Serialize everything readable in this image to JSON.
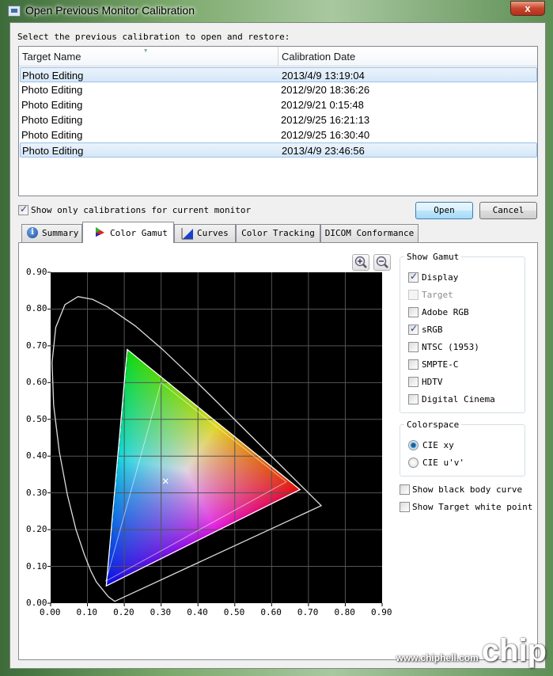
{
  "window": {
    "title": "Open Previous Monitor Calibration",
    "close_label": "x"
  },
  "prompt": "Select the previous calibration to open and restore:",
  "list": {
    "columns": [
      "Target Name",
      "Calibration Date"
    ],
    "rows": [
      {
        "name": "Photo Editing",
        "date": "2013/4/9 13:19:04",
        "selected": true
      },
      {
        "name": "Photo Editing",
        "date": "2012/9/20 18:36:26"
      },
      {
        "name": "Photo Editing",
        "date": "2012/9/21 0:15:48"
      },
      {
        "name": "Photo Editing",
        "date": "2012/9/25 16:21:13"
      },
      {
        "name": "Photo Editing",
        "date": "2012/9/25 16:30:40"
      },
      {
        "name": "Photo Editing",
        "date": "2013/4/9 23:46:56",
        "selected": true
      }
    ]
  },
  "show_only_current": {
    "label": "Show only calibrations for current monitor",
    "checked": true
  },
  "buttons": {
    "open": "Open",
    "cancel": "Cancel"
  },
  "tabs": [
    {
      "label": "Summary",
      "icon": "info-icon"
    },
    {
      "label": "Color Gamut",
      "icon": "color-triangle-icon",
      "active": true
    },
    {
      "label": "Curves",
      "icon": "curve-icon"
    },
    {
      "label": "Color Tracking"
    },
    {
      "label": "DICOM Conformance"
    }
  ],
  "show_gamut": {
    "title": "Show Gamut",
    "items": [
      {
        "label": "Display",
        "checked": true
      },
      {
        "label": "Target",
        "checked": false,
        "disabled": true
      },
      {
        "label": "Adobe RGB",
        "checked": false
      },
      {
        "label": "sRGB",
        "checked": true
      },
      {
        "label": "NTSC (1953)",
        "checked": false
      },
      {
        "label": "SMPTE-C",
        "checked": false
      },
      {
        "label": "HDTV",
        "checked": false
      },
      {
        "label": "Digital Cinema",
        "checked": false
      }
    ]
  },
  "colorspace": {
    "title": "Colorspace",
    "options": [
      {
        "label": "CIE xy",
        "selected": true
      },
      {
        "label": "CIE u'v'",
        "selected": false
      }
    ]
  },
  "extra_options": [
    {
      "label": "Show black body curve",
      "checked": false
    },
    {
      "label": "Show Target white point",
      "checked": false
    }
  ],
  "watermark": "www.chiphell.com",
  "chart_data": {
    "type": "scatter",
    "xlim": [
      0,
      0.9
    ],
    "ylim": [
      0,
      0.9
    ],
    "grid": true,
    "xticks": [
      "0.00",
      "0.10",
      "0.20",
      "0.30",
      "0.40",
      "0.50",
      "0.60",
      "0.70",
      "0.80",
      "0.90"
    ],
    "yticks": [
      "0.00",
      "0.10",
      "0.20",
      "0.30",
      "0.40",
      "0.50",
      "0.60",
      "0.70",
      "0.80",
      "0.90"
    ],
    "background": "#000000",
    "spectral_locus": [
      [
        0.1741,
        0.005
      ],
      [
        0.1566,
        0.0177
      ],
      [
        0.1241,
        0.0578
      ],
      [
        0.1096,
        0.0868
      ],
      [
        0.0913,
        0.1327
      ],
      [
        0.0687,
        0.2007
      ],
      [
        0.0454,
        0.295
      ],
      [
        0.0235,
        0.4127
      ],
      [
        0.0082,
        0.5384
      ],
      [
        0.0039,
        0.6548
      ],
      [
        0.0139,
        0.7502
      ],
      [
        0.0389,
        0.812
      ],
      [
        0.0743,
        0.8338
      ],
      [
        0.1142,
        0.8262
      ],
      [
        0.1547,
        0.8059
      ],
      [
        0.2296,
        0.7543
      ],
      [
        0.3016,
        0.6923
      ],
      [
        0.3731,
        0.6245
      ],
      [
        0.4441,
        0.5547
      ],
      [
        0.5125,
        0.4866
      ],
      [
        0.5752,
        0.4242
      ],
      [
        0.627,
        0.3725
      ],
      [
        0.6915,
        0.3083
      ],
      [
        0.719,
        0.2809
      ],
      [
        0.7347,
        0.2653
      ]
    ],
    "display_gamut": {
      "red": [
        0.677,
        0.309
      ],
      "green": [
        0.208,
        0.69
      ],
      "blue": [
        0.151,
        0.047
      ]
    },
    "srgb_gamut": {
      "red": [
        0.64,
        0.33
      ],
      "green": [
        0.3,
        0.6
      ],
      "blue": [
        0.15,
        0.06
      ]
    },
    "white_point": [
      0.312,
      0.332
    ]
  }
}
